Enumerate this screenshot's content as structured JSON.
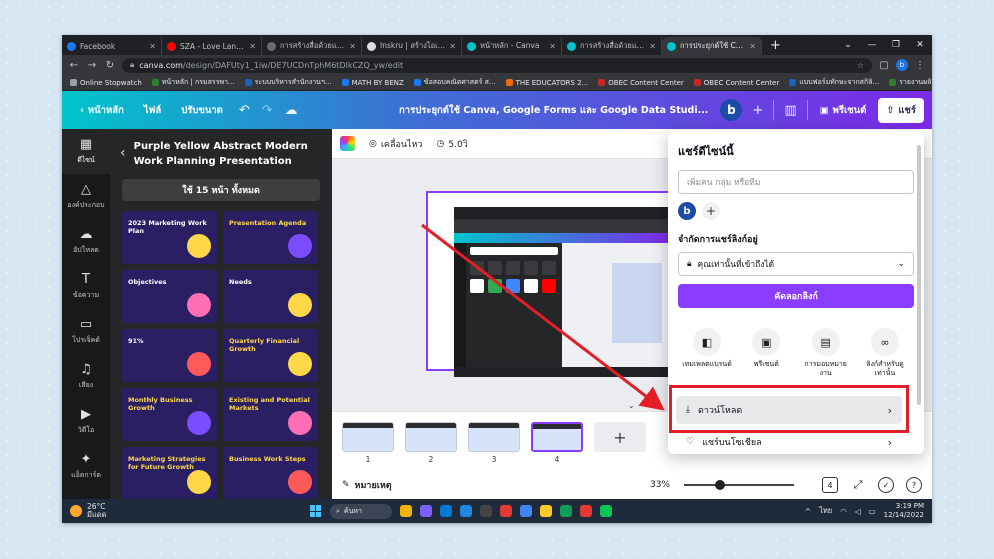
{
  "browser": {
    "tabs": [
      {
        "title": "Facebook",
        "color": "#1877f2"
      },
      {
        "title": "SZA - Love Language",
        "color": "#ff0000"
      },
      {
        "title": "การสร้างสื่อด้วยแพลตฟ...",
        "color": "#6b6b6b"
      },
      {
        "title": "Inskru | สร้างไอเดีย",
        "color": "#dddddd"
      },
      {
        "title": "หน้าหลัก - Canva",
        "color": "#00c4cc"
      },
      {
        "title": "การสร้างสื่อด้วยแพลตฟ...",
        "color": "#00c4cc"
      },
      {
        "title": "การประยุกต์ใช้ Canva, G...",
        "color": "#00c4cc",
        "active": true
      }
    ],
    "new_tab": "+",
    "window_controls": [
      "⌄",
      "—",
      "❐",
      "✕"
    ],
    "url_host": "canva.com",
    "url_path": "/design/DAFUty1_1iw/DE7UCDnTphM6tDlkCZQ_yw/edit",
    "profile_initial": "b",
    "bookmarks": [
      {
        "label": "Online Stopwatch",
        "color": "#9aa0a6"
      },
      {
        "label": "หน้าหลัก | กรมสรรพา...",
        "color": "#2e7d32"
      },
      {
        "label": "ระบบบริหารสำนักงานฯ...",
        "color": "#1565c0"
      },
      {
        "label": "MATH BY BENZ",
        "color": "#1877f2"
      },
      {
        "label": "ข้อสอบคณิตศาสตร์ ส...",
        "color": "#1877f2"
      },
      {
        "label": "THE EDUCATORS 2...",
        "color": "#ef6c00"
      },
      {
        "label": "OBEC Content Center",
        "color": "#c62828"
      },
      {
        "label": "OBEC Content Center",
        "color": "#c62828"
      },
      {
        "label": "แบบฟอร์มทักษะจากสกิลิ...",
        "color": "#1565c0"
      },
      {
        "label": "รายงานผลิติการเรียน...",
        "color": "#2e7d32"
      }
    ]
  },
  "canva_header": {
    "home": "หน้าหลัก",
    "file": "ไฟล์",
    "resize": "ปรับขนาด",
    "title": "การประยุกต์ใช้ Canva, Google Forms และ Google Data Studi...",
    "user_initial": "b",
    "present": "พรีเซนต์",
    "share": "แชร์"
  },
  "rail": [
    {
      "label": "ดีไซน์",
      "icon": "▦"
    },
    {
      "label": "องค์ประกอบ",
      "icon": "△"
    },
    {
      "label": "อัปโหลด",
      "icon": "☁"
    },
    {
      "label": "ข้อความ",
      "icon": "T"
    },
    {
      "label": "โปรเจ็คต์",
      "icon": "▭"
    },
    {
      "label": "เสียง",
      "icon": "♫"
    },
    {
      "label": "วิดีโอ",
      "icon": "▶"
    },
    {
      "label": "แอ็ตการ์ต",
      "icon": "✦"
    }
  ],
  "panel": {
    "title": "Purple Yellow Abstract Modern Work Planning Presentation",
    "use_all": "ใช้ 15 หน้า ทั้งหมด",
    "thumbnails": [
      {
        "text": "2023 Marketing Work Plan",
        "white": true
      },
      {
        "text": "Presentation Agenda",
        "white": false
      },
      {
        "text": "Objectives",
        "white": true
      },
      {
        "text": "Needs",
        "white": true
      },
      {
        "text": "91%",
        "white": true
      },
      {
        "text": "Quarterly Financial Growth",
        "white": false
      },
      {
        "text": "Monthly Business Growth",
        "white": false
      },
      {
        "text": "Existing and Potential Markets",
        "white": false
      },
      {
        "text": "Marketing Strategies for Future Growth",
        "white": false
      },
      {
        "text": "Business Work Steps",
        "white": false
      }
    ]
  },
  "canvas_toolbar": {
    "animate": "เคลื่อนไหว",
    "duration": "5.0วิ"
  },
  "filmstrip": {
    "pages": [
      "1",
      "2",
      "3",
      "4"
    ],
    "selected": 4,
    "add": "+"
  },
  "bottom_bar": {
    "notes": "หมายเหตุ",
    "zoom": "33%",
    "zoom_fraction": 0.33,
    "page_count": "4"
  },
  "share_panel": {
    "title": "แชร์ดีไซน์นี้",
    "people_placeholder": "เพิ่มคน กลุ่ม หรือทีม",
    "owner_initial": "b",
    "link_access_label": "จำกัดการแชร์ลิงก์อยู่",
    "link_access_value": "คุณเท่านั้นที่เข้าถึงได้",
    "copy_link": "คัดลอกลิงก์",
    "actions": [
      {
        "label": "เทมเพลตแบรนด์",
        "icon": "◧"
      },
      {
        "label": "พรีเซนต์",
        "icon": "▣"
      },
      {
        "label": "การมอบหมายงาน",
        "icon": "▤"
      },
      {
        "label": "ลิงก์สำหรับดูเท่านั้น",
        "icon": "∞"
      }
    ],
    "download": "ดาวน์โหลด",
    "social": "แชร์บนโซเชียล"
  },
  "taskbar": {
    "temp": "26°C",
    "weather": "มีแดด",
    "search": "ค้นหา",
    "lang": "ไทย",
    "time": "3:19 PM",
    "date": "12/14/2022",
    "apps": [
      "#f4b400",
      "#7b61ff",
      "#0078d4",
      "#1e88e5",
      "#444444",
      "#e53935",
      "#4285f4",
      "#ffca28",
      "#0f9d58",
      "#e53935",
      "#06c755"
    ]
  }
}
